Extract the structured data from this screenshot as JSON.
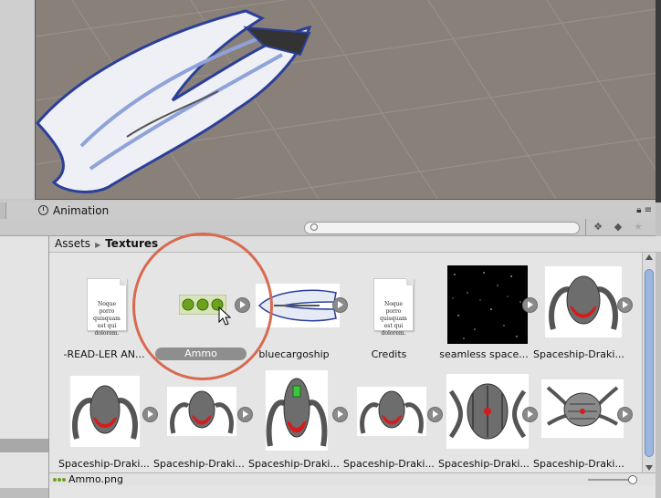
{
  "panel_tab": {
    "label": "Animation",
    "icon": "clock-icon"
  },
  "tab_icons": {
    "lock": "lock-icon",
    "menu": "menu-icon"
  },
  "toolbar": {
    "search_placeholder": "",
    "filter_type_icon": "filter-by-type-icon",
    "filter_label_icon": "filter-by-label-icon",
    "favorite_icon": "star-icon"
  },
  "breadcrumb": {
    "root": "Assets",
    "current": "Textures"
  },
  "assets": [
    {
      "label": "-READ-LER AN...",
      "kind": "document",
      "doc_text": "Noque porro quisquam est qui dolorem."
    },
    {
      "label": "Ammo",
      "kind": "ammo",
      "selected": true
    },
    {
      "label": "bluecargoship",
      "kind": "ship"
    },
    {
      "label": "Credits",
      "kind": "document",
      "doc_text": "Noque porro quisquam est qui dolorem."
    },
    {
      "label": "seamless space...",
      "kind": "space"
    },
    {
      "label": "Spaceship-Draki...",
      "kind": "drakir"
    },
    {
      "label": "Spaceship-Draki...",
      "kind": "drakir"
    },
    {
      "label": "Spaceship-Draki...",
      "kind": "drakir"
    },
    {
      "label": "Spaceship-Draki...",
      "kind": "drakir"
    },
    {
      "label": "Spaceship-Draki...",
      "kind": "drakir"
    },
    {
      "label": "Spaceship-Draki...",
      "kind": "drakir"
    },
    {
      "label": "Spaceship-Draki...",
      "kind": "drakir"
    }
  ],
  "status": {
    "selected_file": "Ammo.png"
  },
  "colors": {
    "highlight": "#d76a4f",
    "scene_bg": "#8a807a",
    "scrollbar_thumb": "#9bb7e0"
  }
}
